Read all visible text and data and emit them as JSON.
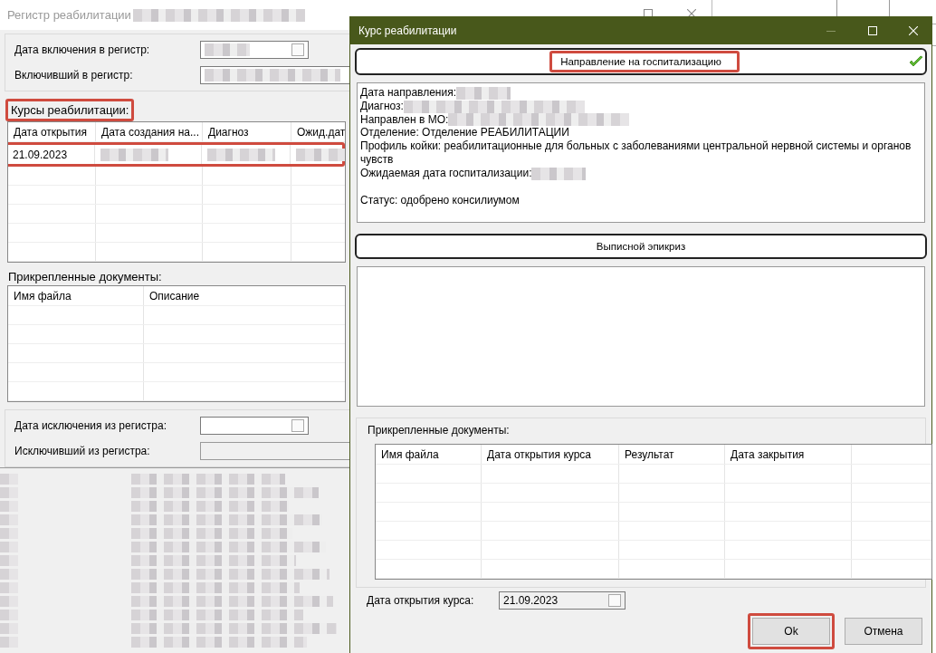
{
  "background_window": {
    "title": "Регистр реабилитации",
    "title_redacted": true,
    "inclusion_fields": [
      {
        "label": "Дата включения в регистр:",
        "kind": "date",
        "redacted": true
      },
      {
        "label": "Включивший в регистр:",
        "kind": "text",
        "redacted": true
      }
    ],
    "courses": {
      "label": "Курсы реабилитации:",
      "highlighted": true,
      "columns": [
        "Дата открытия",
        "Дата создания на...",
        "Диагноз",
        "Ожид.дат"
      ],
      "rows": [
        {
          "highlighted": true,
          "cells": [
            {
              "kind": "text",
              "text": "21.09.2023"
            },
            {
              "kind": "redacted"
            },
            {
              "kind": "redacted"
            },
            {
              "kind": "redacted"
            }
          ]
        }
      ]
    },
    "documents": {
      "label": "Прикрепленные документы:",
      "columns": [
        "Имя файла",
        "Описание"
      ]
    },
    "exclusion_fields": [
      {
        "label": "Дата исключения из регистра:",
        "kind": "date",
        "redacted": false
      },
      {
        "label": "Исключивший из регистра:",
        "kind": "text",
        "redacted": false
      }
    ],
    "lower_grid": {
      "redacted": true
    }
  },
  "dialog": {
    "title": "Курс реабилитации",
    "referral_button": {
      "label": "Направление на госпитализацию",
      "highlighted": true,
      "checked": true
    },
    "details": [
      {
        "kind": "line",
        "text": "Дата направления:",
        "redacted": true
      },
      {
        "kind": "line",
        "text": "Диагноз:",
        "redacted": true
      },
      {
        "kind": "line",
        "text": "Направлен в МО:",
        "redacted": true
      },
      {
        "kind": "line",
        "text": "Отделение: Отделение РЕАБИЛИТАЦИИ",
        "redacted": false
      },
      {
        "kind": "line",
        "text": "Профиль койки: реабилитационные для больных с заболеваниями центральной нервной системы и органов чувств",
        "redacted": false
      },
      {
        "kind": "line",
        "text": "Ожидаемая дата госпитализации:",
        "redacted": true
      },
      {
        "kind": "status",
        "text": "Статус: одобрено консилиумом",
        "redacted": false
      }
    ],
    "discharge_button": {
      "label": "Выписной эпикриз"
    },
    "documents": {
      "label": "Прикрепленные документы:",
      "columns": [
        "Имя файла",
        "Дата открытия курса",
        "Результат",
        "Дата закрытия"
      ]
    },
    "open_date": {
      "label": "Дата открытия курса:",
      "value": "21.09.2023"
    },
    "buttons": [
      {
        "label": "Ok",
        "highlighted": true
      },
      {
        "label": "Отмена",
        "highlighted": false
      }
    ]
  }
}
